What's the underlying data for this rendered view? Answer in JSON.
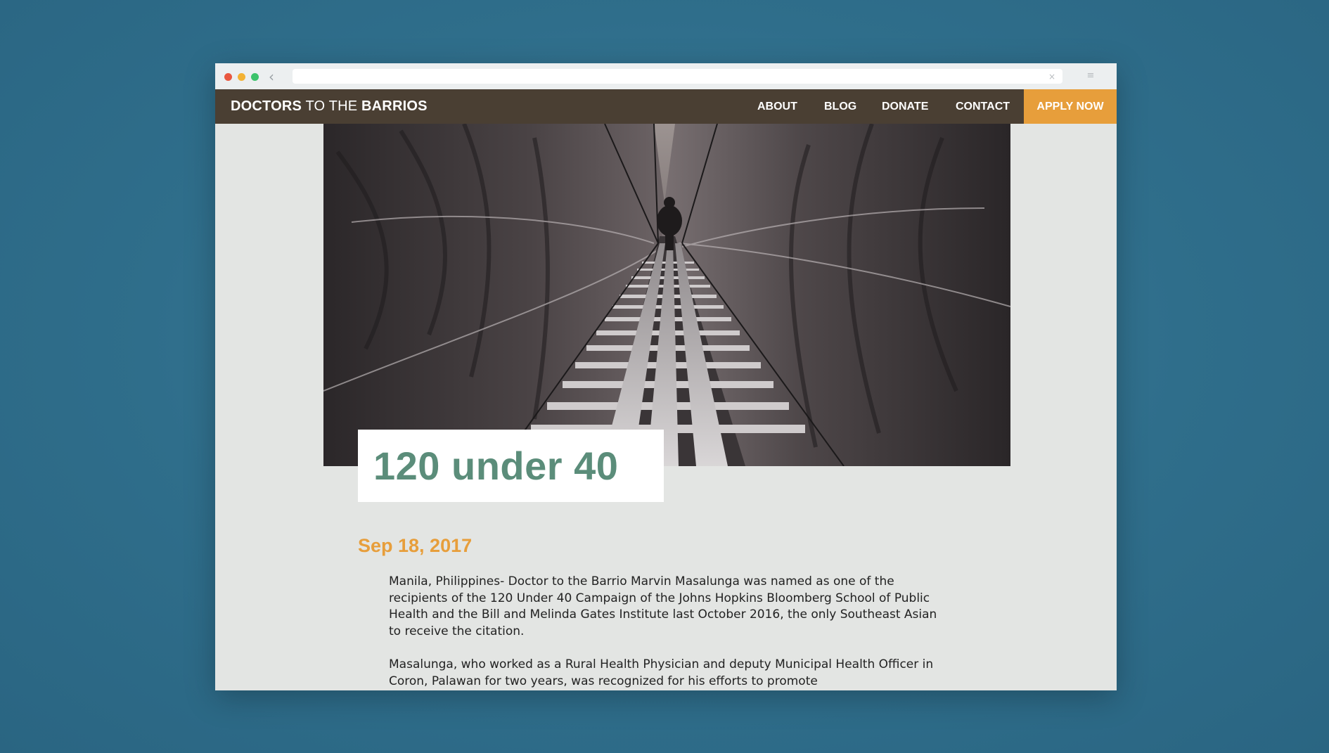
{
  "browser": {
    "url": "",
    "url_clear_glyph": "×",
    "back_glyph": "‹",
    "menu_glyph": "≡"
  },
  "header": {
    "logo_part1": "DOCTORS",
    "logo_part2": " TO THE ",
    "logo_part3": "BARRIOS"
  },
  "nav": {
    "items": [
      {
        "label": "ABOUT"
      },
      {
        "label": "BLOG"
      },
      {
        "label": "DONATE"
      },
      {
        "label": "CONTACT"
      }
    ],
    "cta_label": "APPLY NOW"
  },
  "post": {
    "title": "120 under 40",
    "date": "Sep 18, 2017",
    "paragraphs": [
      "Manila, Philippines- Doctor to the Barrio Marvin Masalunga was named as one of the recipients of the 120 Under 40 Campaign of the Johns Hopkins Bloomberg School of Public Health and the Bill and Melinda Gates Institute last October 2016, the only Southeast Asian to receive the citation.",
      "Masalunga, who worked as a Rural Health Physician and deputy Municipal Health Officer in Coron, Palawan for two years, was recognized for his efforts to promote"
    ]
  },
  "colors": {
    "navbar": "#4a3f33",
    "accent": "#e79e3b",
    "title": "#5b8d7a",
    "page_bg": "#e3e5e3"
  }
}
